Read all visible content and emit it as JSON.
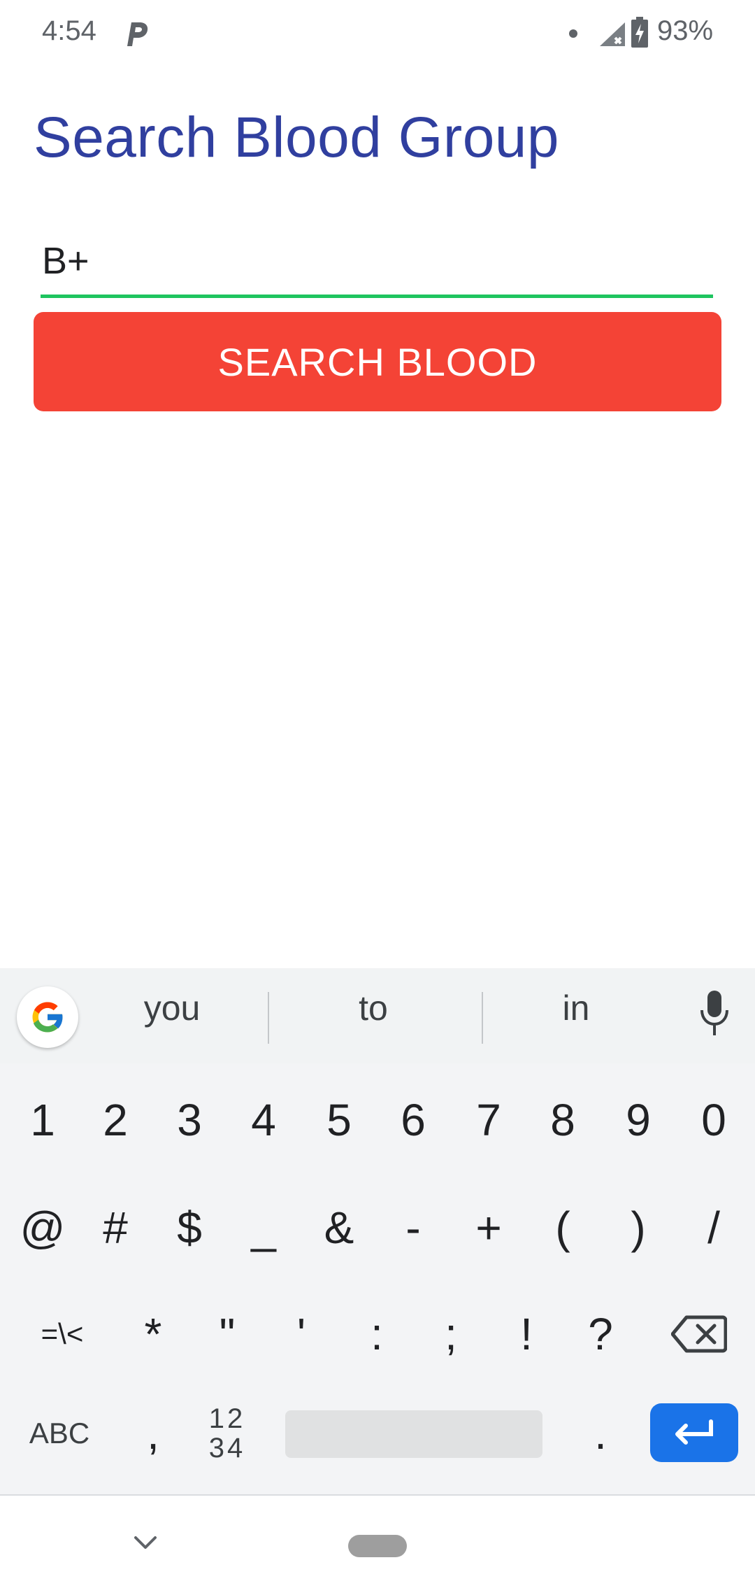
{
  "status_bar": {
    "time": "4:54",
    "battery": "93%",
    "icons": [
      "parking-notification-icon",
      "dot-icon",
      "signal-no-data-icon",
      "battery-charging-icon"
    ]
  },
  "page": {
    "title": "Search Blood Group",
    "input_value": "B+",
    "button_label": "SEARCH BLOOD",
    "colors": {
      "title": "#303f9f",
      "button": "#f44336",
      "input_underline": "#1ec45f"
    }
  },
  "keyboard": {
    "suggestions": [
      "you",
      "to",
      "in"
    ],
    "row1": [
      "1",
      "2",
      "3",
      "4",
      "5",
      "6",
      "7",
      "8",
      "9",
      "0"
    ],
    "row2": [
      "@",
      "#",
      "$",
      "_",
      "&",
      "-",
      "+",
      "(",
      ")",
      "/"
    ],
    "row3": [
      "=\\<",
      "*",
      "\"",
      "'",
      ":",
      ";",
      "!",
      "?"
    ],
    "abc_label": "ABC",
    "comma": ",",
    "num_top": "12",
    "num_bottom": "34",
    "period": ".",
    "enter_color": "#1a73e8"
  }
}
